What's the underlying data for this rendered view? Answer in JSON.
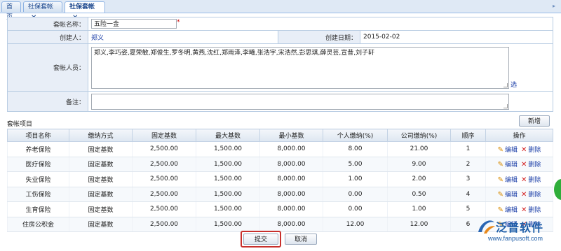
{
  "tabs": [
    {
      "label": "首页",
      "closable": false,
      "active": false
    },
    {
      "label": "社保套帐",
      "closable": true,
      "active": false
    },
    {
      "label": "社保套帐",
      "closable": true,
      "active": true
    }
  ],
  "form": {
    "name_label": "套帐名称：",
    "name_value": "五险一金",
    "required_mark": "*",
    "creator_label": "创建人：",
    "creator_value": "郑义",
    "date_label": "创建日期：",
    "date_value": "2015-02-02",
    "members_label": "套帐人员：",
    "members_value": "郑义,李巧姿,夏荣敏,郑俊生,罗冬明,黄燕,沈红,郑雨泽,李曦,张浩宇,宋浩然,彭思琪,薛灵芸,宣昔,刘子轩",
    "select_link": "选",
    "remark_label": "备注：",
    "remark_value": ""
  },
  "items_section": {
    "title": "套帐项目",
    "add_button": "新增",
    "columns": [
      "项目名称",
      "缴纳方式",
      "固定基数",
      "最大基数",
      "最小基数",
      "个人缴纳(%)",
      "公司缴纳(%)",
      "顺序",
      "操作"
    ],
    "edit_label": "编辑",
    "delete_label": "删除",
    "rows": [
      {
        "name": "养老保险",
        "method": "固定基数",
        "fixed": "2,500.00",
        "max": "1,500.00",
        "min": "8,000.00",
        "personal": "8.00",
        "company": "21.00",
        "order": "1"
      },
      {
        "name": "医疗保险",
        "method": "固定基数",
        "fixed": "2,500.00",
        "max": "1,500.00",
        "min": "8,000.00",
        "personal": "5.00",
        "company": "9.00",
        "order": "2"
      },
      {
        "name": "失业保险",
        "method": "固定基数",
        "fixed": "2,500.00",
        "max": "1,500.00",
        "min": "8,000.00",
        "personal": "1.00",
        "company": "2.00",
        "order": "3"
      },
      {
        "name": "工伤保险",
        "method": "固定基数",
        "fixed": "2,500.00",
        "max": "1,500.00",
        "min": "8,000.00",
        "personal": "0.00",
        "company": "0.50",
        "order": "4"
      },
      {
        "name": "生育保险",
        "method": "固定基数",
        "fixed": "2,500.00",
        "max": "1,500.00",
        "min": "8,000.00",
        "personal": "0.00",
        "company": "1.00",
        "order": "5"
      },
      {
        "name": "住房公积金",
        "method": "固定基数",
        "fixed": "2,500.00",
        "max": "1,500.00",
        "min": "8,000.00",
        "personal": "12.00",
        "company": "12.00",
        "order": "6"
      }
    ]
  },
  "actions": {
    "submit": "提交",
    "cancel": "取消"
  },
  "watermark": {
    "brand": "泛普软件",
    "url": "www.fanpusoft.com"
  },
  "colors": {
    "accent": "#15428b",
    "highlight_border": "#c8302c",
    "link": "#1c3fa8",
    "brand": "#1f5ea8"
  }
}
